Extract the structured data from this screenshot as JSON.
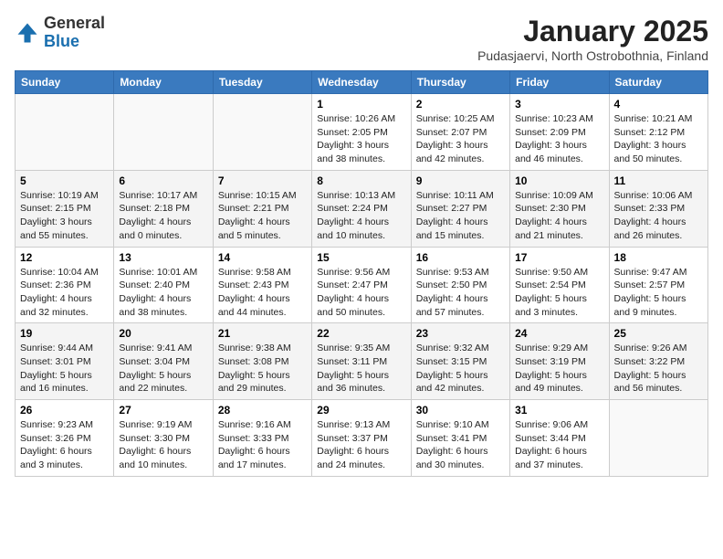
{
  "header": {
    "logo_general": "General",
    "logo_blue": "Blue",
    "month_title": "January 2025",
    "location": "Pudasjaervi, North Ostrobothnia, Finland"
  },
  "weekdays": [
    "Sunday",
    "Monday",
    "Tuesday",
    "Wednesday",
    "Thursday",
    "Friday",
    "Saturday"
  ],
  "weeks": [
    [
      {
        "day": "",
        "text": ""
      },
      {
        "day": "",
        "text": ""
      },
      {
        "day": "",
        "text": ""
      },
      {
        "day": "1",
        "text": "Sunrise: 10:26 AM\nSunset: 2:05 PM\nDaylight: 3 hours and 38 minutes."
      },
      {
        "day": "2",
        "text": "Sunrise: 10:25 AM\nSunset: 2:07 PM\nDaylight: 3 hours and 42 minutes."
      },
      {
        "day": "3",
        "text": "Sunrise: 10:23 AM\nSunset: 2:09 PM\nDaylight: 3 hours and 46 minutes."
      },
      {
        "day": "4",
        "text": "Sunrise: 10:21 AM\nSunset: 2:12 PM\nDaylight: 3 hours and 50 minutes."
      }
    ],
    [
      {
        "day": "5",
        "text": "Sunrise: 10:19 AM\nSunset: 2:15 PM\nDaylight: 3 hours and 55 minutes."
      },
      {
        "day": "6",
        "text": "Sunrise: 10:17 AM\nSunset: 2:18 PM\nDaylight: 4 hours and 0 minutes."
      },
      {
        "day": "7",
        "text": "Sunrise: 10:15 AM\nSunset: 2:21 PM\nDaylight: 4 hours and 5 minutes."
      },
      {
        "day": "8",
        "text": "Sunrise: 10:13 AM\nSunset: 2:24 PM\nDaylight: 4 hours and 10 minutes."
      },
      {
        "day": "9",
        "text": "Sunrise: 10:11 AM\nSunset: 2:27 PM\nDaylight: 4 hours and 15 minutes."
      },
      {
        "day": "10",
        "text": "Sunrise: 10:09 AM\nSunset: 2:30 PM\nDaylight: 4 hours and 21 minutes."
      },
      {
        "day": "11",
        "text": "Sunrise: 10:06 AM\nSunset: 2:33 PM\nDaylight: 4 hours and 26 minutes."
      }
    ],
    [
      {
        "day": "12",
        "text": "Sunrise: 10:04 AM\nSunset: 2:36 PM\nDaylight: 4 hours and 32 minutes."
      },
      {
        "day": "13",
        "text": "Sunrise: 10:01 AM\nSunset: 2:40 PM\nDaylight: 4 hours and 38 minutes."
      },
      {
        "day": "14",
        "text": "Sunrise: 9:58 AM\nSunset: 2:43 PM\nDaylight: 4 hours and 44 minutes."
      },
      {
        "day": "15",
        "text": "Sunrise: 9:56 AM\nSunset: 2:47 PM\nDaylight: 4 hours and 50 minutes."
      },
      {
        "day": "16",
        "text": "Sunrise: 9:53 AM\nSunset: 2:50 PM\nDaylight: 4 hours and 57 minutes."
      },
      {
        "day": "17",
        "text": "Sunrise: 9:50 AM\nSunset: 2:54 PM\nDaylight: 5 hours and 3 minutes."
      },
      {
        "day": "18",
        "text": "Sunrise: 9:47 AM\nSunset: 2:57 PM\nDaylight: 5 hours and 9 minutes."
      }
    ],
    [
      {
        "day": "19",
        "text": "Sunrise: 9:44 AM\nSunset: 3:01 PM\nDaylight: 5 hours and 16 minutes."
      },
      {
        "day": "20",
        "text": "Sunrise: 9:41 AM\nSunset: 3:04 PM\nDaylight: 5 hours and 22 minutes."
      },
      {
        "day": "21",
        "text": "Sunrise: 9:38 AM\nSunset: 3:08 PM\nDaylight: 5 hours and 29 minutes."
      },
      {
        "day": "22",
        "text": "Sunrise: 9:35 AM\nSunset: 3:11 PM\nDaylight: 5 hours and 36 minutes."
      },
      {
        "day": "23",
        "text": "Sunrise: 9:32 AM\nSunset: 3:15 PM\nDaylight: 5 hours and 42 minutes."
      },
      {
        "day": "24",
        "text": "Sunrise: 9:29 AM\nSunset: 3:19 PM\nDaylight: 5 hours and 49 minutes."
      },
      {
        "day": "25",
        "text": "Sunrise: 9:26 AM\nSunset: 3:22 PM\nDaylight: 5 hours and 56 minutes."
      }
    ],
    [
      {
        "day": "26",
        "text": "Sunrise: 9:23 AM\nSunset: 3:26 PM\nDaylight: 6 hours and 3 minutes."
      },
      {
        "day": "27",
        "text": "Sunrise: 9:19 AM\nSunset: 3:30 PM\nDaylight: 6 hours and 10 minutes."
      },
      {
        "day": "28",
        "text": "Sunrise: 9:16 AM\nSunset: 3:33 PM\nDaylight: 6 hours and 17 minutes."
      },
      {
        "day": "29",
        "text": "Sunrise: 9:13 AM\nSunset: 3:37 PM\nDaylight: 6 hours and 24 minutes."
      },
      {
        "day": "30",
        "text": "Sunrise: 9:10 AM\nSunset: 3:41 PM\nDaylight: 6 hours and 30 minutes."
      },
      {
        "day": "31",
        "text": "Sunrise: 9:06 AM\nSunset: 3:44 PM\nDaylight: 6 hours and 37 minutes."
      },
      {
        "day": "",
        "text": ""
      }
    ]
  ]
}
